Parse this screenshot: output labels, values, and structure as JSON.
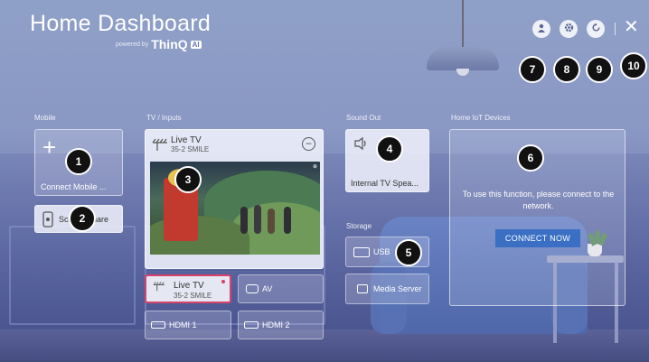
{
  "header": {
    "title": "Home Dashboard",
    "powered_by": "powered by",
    "brand": "ThinQ",
    "brand_badge": "AI"
  },
  "top_buttons": {
    "account_icon": "account-icon",
    "settings_icon": "gear-icon",
    "refresh_icon": "refresh-icon",
    "close_glyph": "✕"
  },
  "sections": {
    "mobile": "Mobile",
    "tv_inputs": "TV / Inputs",
    "sound_out": "Sound Out",
    "iot": "Home IoT Devices",
    "storage": "Storage"
  },
  "mobile": {
    "connect_label": "Connect Mobile ...",
    "screen_share_label": "Screen Share"
  },
  "livetv": {
    "title": "Live TV",
    "channel": "35-2 SMILE",
    "preview_logo": "⊕"
  },
  "inputs": [
    {
      "label": "Live TV",
      "sub": "35-2 SMILE"
    },
    {
      "label": "AV"
    },
    {
      "label": "HDMI 1"
    },
    {
      "label": "HDMI 2"
    }
  ],
  "sound": {
    "label": "Internal TV Spea..."
  },
  "storage": {
    "usb": "USB",
    "media_server": "Media Server"
  },
  "iot": {
    "message": "To use this function, please connect to the network.",
    "button": "CONNECT NOW"
  },
  "markers": [
    "1",
    "2",
    "3",
    "4",
    "5",
    "6",
    "7",
    "8",
    "9",
    "10"
  ],
  "colors": {
    "accent_button": "#3a6fc4",
    "selected_border": "#d8436a"
  }
}
